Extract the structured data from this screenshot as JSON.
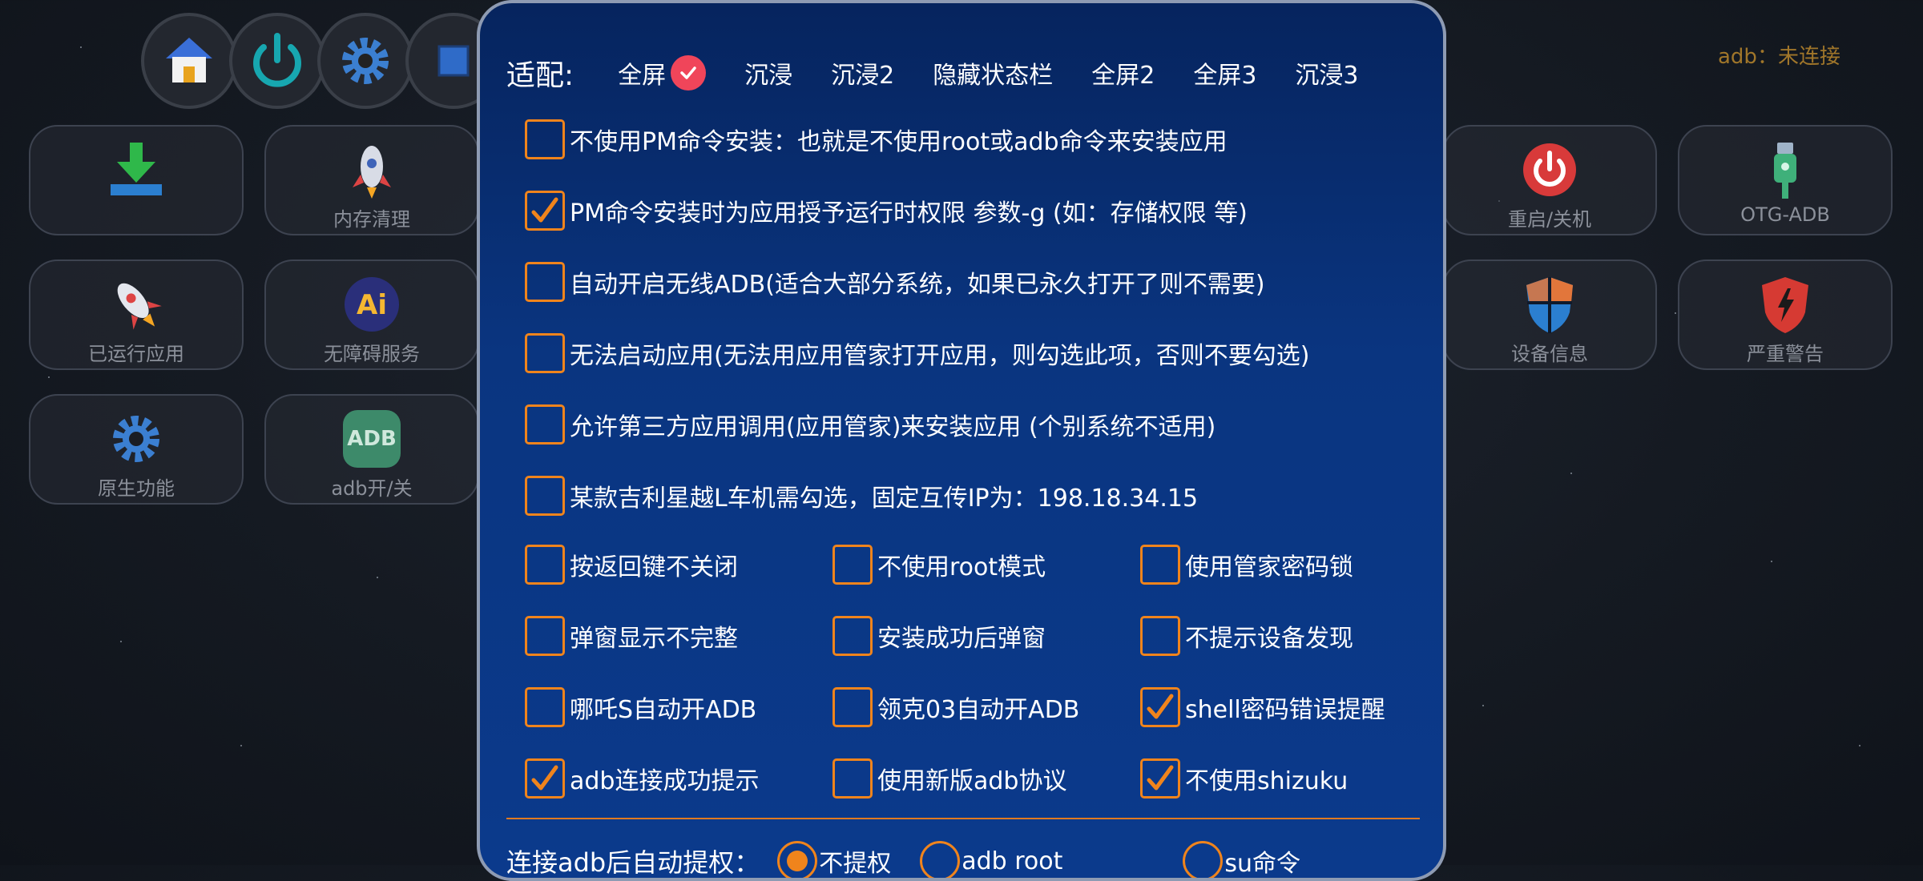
{
  "top_icons": [
    "home-icon",
    "power-icon",
    "gear-icon",
    "square-icon"
  ],
  "adb_status": "adb：未连接",
  "tiles_left": [
    {
      "label": "",
      "icon": "download-icon"
    },
    {
      "label": "内存清理",
      "icon": "rocket-icon"
    },
    {
      "label": "已运行应用",
      "icon": "rocket-icon"
    },
    {
      "label": "无障碍服务",
      "icon": "ai-icon"
    },
    {
      "label": "原生功能",
      "icon": "gear-icon"
    },
    {
      "label": "adb开/关",
      "icon": "adb-icon",
      "icon_text": "ADB"
    }
  ],
  "tiles_right": [
    {
      "label": "重启/关机",
      "icon": "power-icon"
    },
    {
      "label": "OTG-ADB",
      "icon": "usb-icon"
    },
    {
      "label": "设备信息",
      "icon": "shield-icon"
    },
    {
      "label": "严重警告",
      "icon": "warning-shield-icon"
    }
  ],
  "dialog": {
    "fit": {
      "title": "适配:",
      "options": [
        {
          "label": "全屏",
          "selected": true
        },
        {
          "label": "沉浸",
          "selected": false
        },
        {
          "label": "沉浸2",
          "selected": false
        },
        {
          "label": "隐藏状态栏",
          "selected": false
        },
        {
          "label": "全屏2",
          "selected": false
        },
        {
          "label": "全屏3",
          "selected": false
        },
        {
          "label": "沉浸3",
          "selected": false
        }
      ]
    },
    "full_options": [
      {
        "label": "不使用PM命令安装：也就是不使用root或adb命令来安装应用",
        "checked": false
      },
      {
        "label": "PM命令安装时为应用授予运行时权限 参数-g (如：存储权限 等)",
        "checked": true
      },
      {
        "label": "自动开启无线ADB(适合大部分系统，如果已永久打开了则不需要)",
        "checked": false
      },
      {
        "label": "无法启动应用(无法用应用管家打开应用，则勾选此项，否则不要勾选)",
        "checked": false
      },
      {
        "label": "允许第三方应用调用(应用管家)来安装应用  (个别系统不适用)",
        "checked": false
      },
      {
        "label": "某款吉利星越L车机需勾选，固定互传IP为：198.18.34.15",
        "checked": false
      }
    ],
    "grid_options": [
      [
        {
          "label": "按返回键不关闭",
          "checked": false
        },
        {
          "label": "不使用root模式",
          "checked": false
        },
        {
          "label": "使用管家密码锁",
          "checked": false
        }
      ],
      [
        {
          "label": "弹窗显示不完整",
          "checked": false
        },
        {
          "label": "安装成功后弹窗",
          "checked": false
        },
        {
          "label": "不提示设备发现",
          "checked": false
        }
      ],
      [
        {
          "label": "哪吒S自动开ADB",
          "checked": false
        },
        {
          "label": "领克03自动开ADB",
          "checked": false
        },
        {
          "label": "shell密码错误提醒",
          "checked": true
        }
      ],
      [
        {
          "label": "adb连接成功提示",
          "checked": true
        },
        {
          "label": "使用新版adb协议",
          "checked": false
        },
        {
          "label": "不使用shizuku",
          "checked": true
        }
      ]
    ],
    "auth": {
      "title": "连接adb后自动提权：",
      "options": [
        {
          "label": "不提权",
          "selected": true
        },
        {
          "label": "adb root",
          "selected": false
        },
        {
          "label": "su命令",
          "selected": false
        }
      ]
    }
  },
  "colors": {
    "accent_orange": "#f0841c",
    "check_red": "#f0455a",
    "dialog_blue": "#0a3580",
    "status_gold": "#a0762a"
  }
}
